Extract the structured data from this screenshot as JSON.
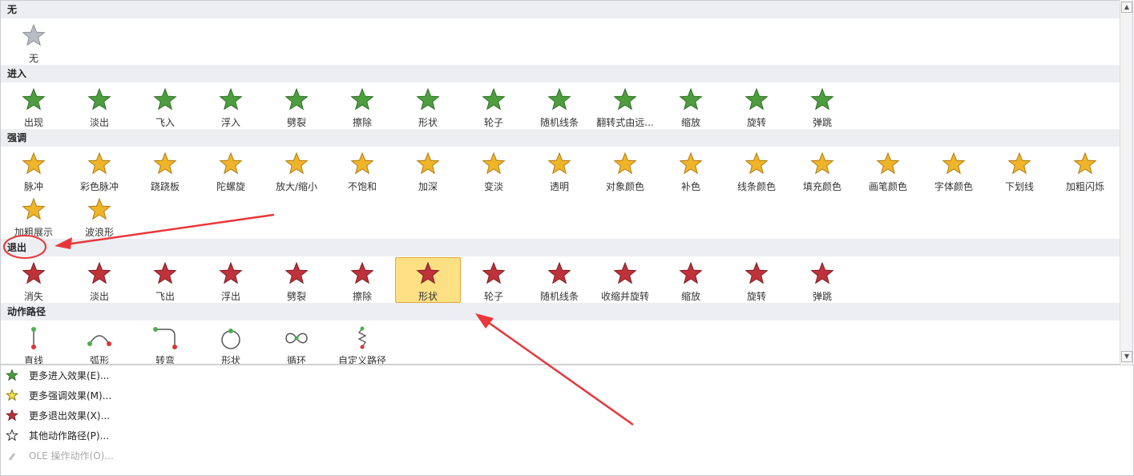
{
  "sections": [
    {
      "title": "无",
      "items": [
        {
          "label": "无",
          "icon": "star-none-icon"
        }
      ]
    },
    {
      "title": "进入",
      "items": [
        {
          "label": "出现",
          "icon": "star-green-icon"
        },
        {
          "label": "淡出",
          "icon": "star-green-icon"
        },
        {
          "label": "飞入",
          "icon": "star-green-icon"
        },
        {
          "label": "浮入",
          "icon": "star-green-icon"
        },
        {
          "label": "劈裂",
          "icon": "star-green-icon"
        },
        {
          "label": "擦除",
          "icon": "star-green-icon"
        },
        {
          "label": "形状",
          "icon": "star-green-icon"
        },
        {
          "label": "轮子",
          "icon": "star-green-icon"
        },
        {
          "label": "随机线条",
          "icon": "star-green-icon"
        },
        {
          "label": "翻转式由远...",
          "icon": "star-green-icon"
        },
        {
          "label": "缩放",
          "icon": "star-green-icon"
        },
        {
          "label": "旋转",
          "icon": "star-green-icon"
        },
        {
          "label": "弹跳",
          "icon": "star-green-icon"
        }
      ]
    },
    {
      "title": "强调",
      "items": [
        {
          "label": "脉冲",
          "icon": "star-gold-icon"
        },
        {
          "label": "彩色脉冲",
          "icon": "star-gold-icon"
        },
        {
          "label": "跷跷板",
          "icon": "star-gold-icon"
        },
        {
          "label": "陀螺旋",
          "icon": "star-gold-icon"
        },
        {
          "label": "放大/缩小",
          "icon": "star-gold-icon"
        },
        {
          "label": "不饱和",
          "icon": "star-gold-icon"
        },
        {
          "label": "加深",
          "icon": "star-gold-icon"
        },
        {
          "label": "变淡",
          "icon": "star-gold-icon"
        },
        {
          "label": "透明",
          "icon": "star-gold-icon"
        },
        {
          "label": "对象颜色",
          "icon": "star-gold-icon"
        },
        {
          "label": "补色",
          "icon": "star-gold-icon"
        },
        {
          "label": "线条颜色",
          "icon": "star-gold-icon"
        },
        {
          "label": "填充颜色",
          "icon": "star-gold-icon"
        },
        {
          "label": "画笔颜色",
          "icon": "star-gold-icon"
        },
        {
          "label": "字体颜色",
          "icon": "star-gold-icon"
        },
        {
          "label": "下划线",
          "icon": "star-gold-icon"
        },
        {
          "label": "加粗闪烁",
          "icon": "star-gold-icon"
        },
        {
          "label": "加粗展示",
          "icon": "star-gold-icon"
        },
        {
          "label": "波浪形",
          "icon": "star-gold-icon"
        }
      ]
    },
    {
      "title": "退出",
      "items": [
        {
          "label": "消失",
          "icon": "star-red-icon"
        },
        {
          "label": "淡出",
          "icon": "star-red-icon"
        },
        {
          "label": "飞出",
          "icon": "star-red-icon"
        },
        {
          "label": "浮出",
          "icon": "star-red-icon"
        },
        {
          "label": "劈裂",
          "icon": "star-red-icon"
        },
        {
          "label": "擦除",
          "icon": "star-red-icon"
        },
        {
          "label": "形状",
          "icon": "star-red-icon",
          "selected": true
        },
        {
          "label": "轮子",
          "icon": "star-red-icon"
        },
        {
          "label": "随机线条",
          "icon": "star-red-icon"
        },
        {
          "label": "收缩并旋转",
          "icon": "star-red-icon"
        },
        {
          "label": "缩放",
          "icon": "star-red-icon"
        },
        {
          "label": "旋转",
          "icon": "star-red-icon"
        },
        {
          "label": "弹跳",
          "icon": "star-red-icon"
        }
      ]
    },
    {
      "title": "动作路径",
      "items": [
        {
          "label": "直线",
          "icon": "path-line-icon"
        },
        {
          "label": "弧形",
          "icon": "path-arc-icon"
        },
        {
          "label": "转弯",
          "icon": "path-turn-icon"
        },
        {
          "label": "形状",
          "icon": "path-circle-icon"
        },
        {
          "label": "循环",
          "icon": "path-loop-icon"
        },
        {
          "label": "自定义路径",
          "icon": "path-custom-icon"
        }
      ]
    }
  ],
  "commands": [
    {
      "label": "更多进入效果(E)...",
      "icon": "star-green-icon",
      "enabled": true
    },
    {
      "label": "更多强调效果(M)...",
      "icon": "star-yellow-icon",
      "enabled": true
    },
    {
      "label": "更多退出效果(X)...",
      "icon": "star-red-icon",
      "enabled": true
    },
    {
      "label": "其他动作路径(P)...",
      "icon": "star-outline-icon",
      "enabled": true
    },
    {
      "label": "OLE 操作动作(O)...",
      "icon": "ole-action-icon",
      "enabled": false
    }
  ],
  "colors": {
    "green": "#4e9e3f",
    "gold": "#f0b429",
    "red": "#c0323a",
    "selected_bg": "#fddf84",
    "header_bg": "#eceef2",
    "annotation": "#e8373a"
  }
}
